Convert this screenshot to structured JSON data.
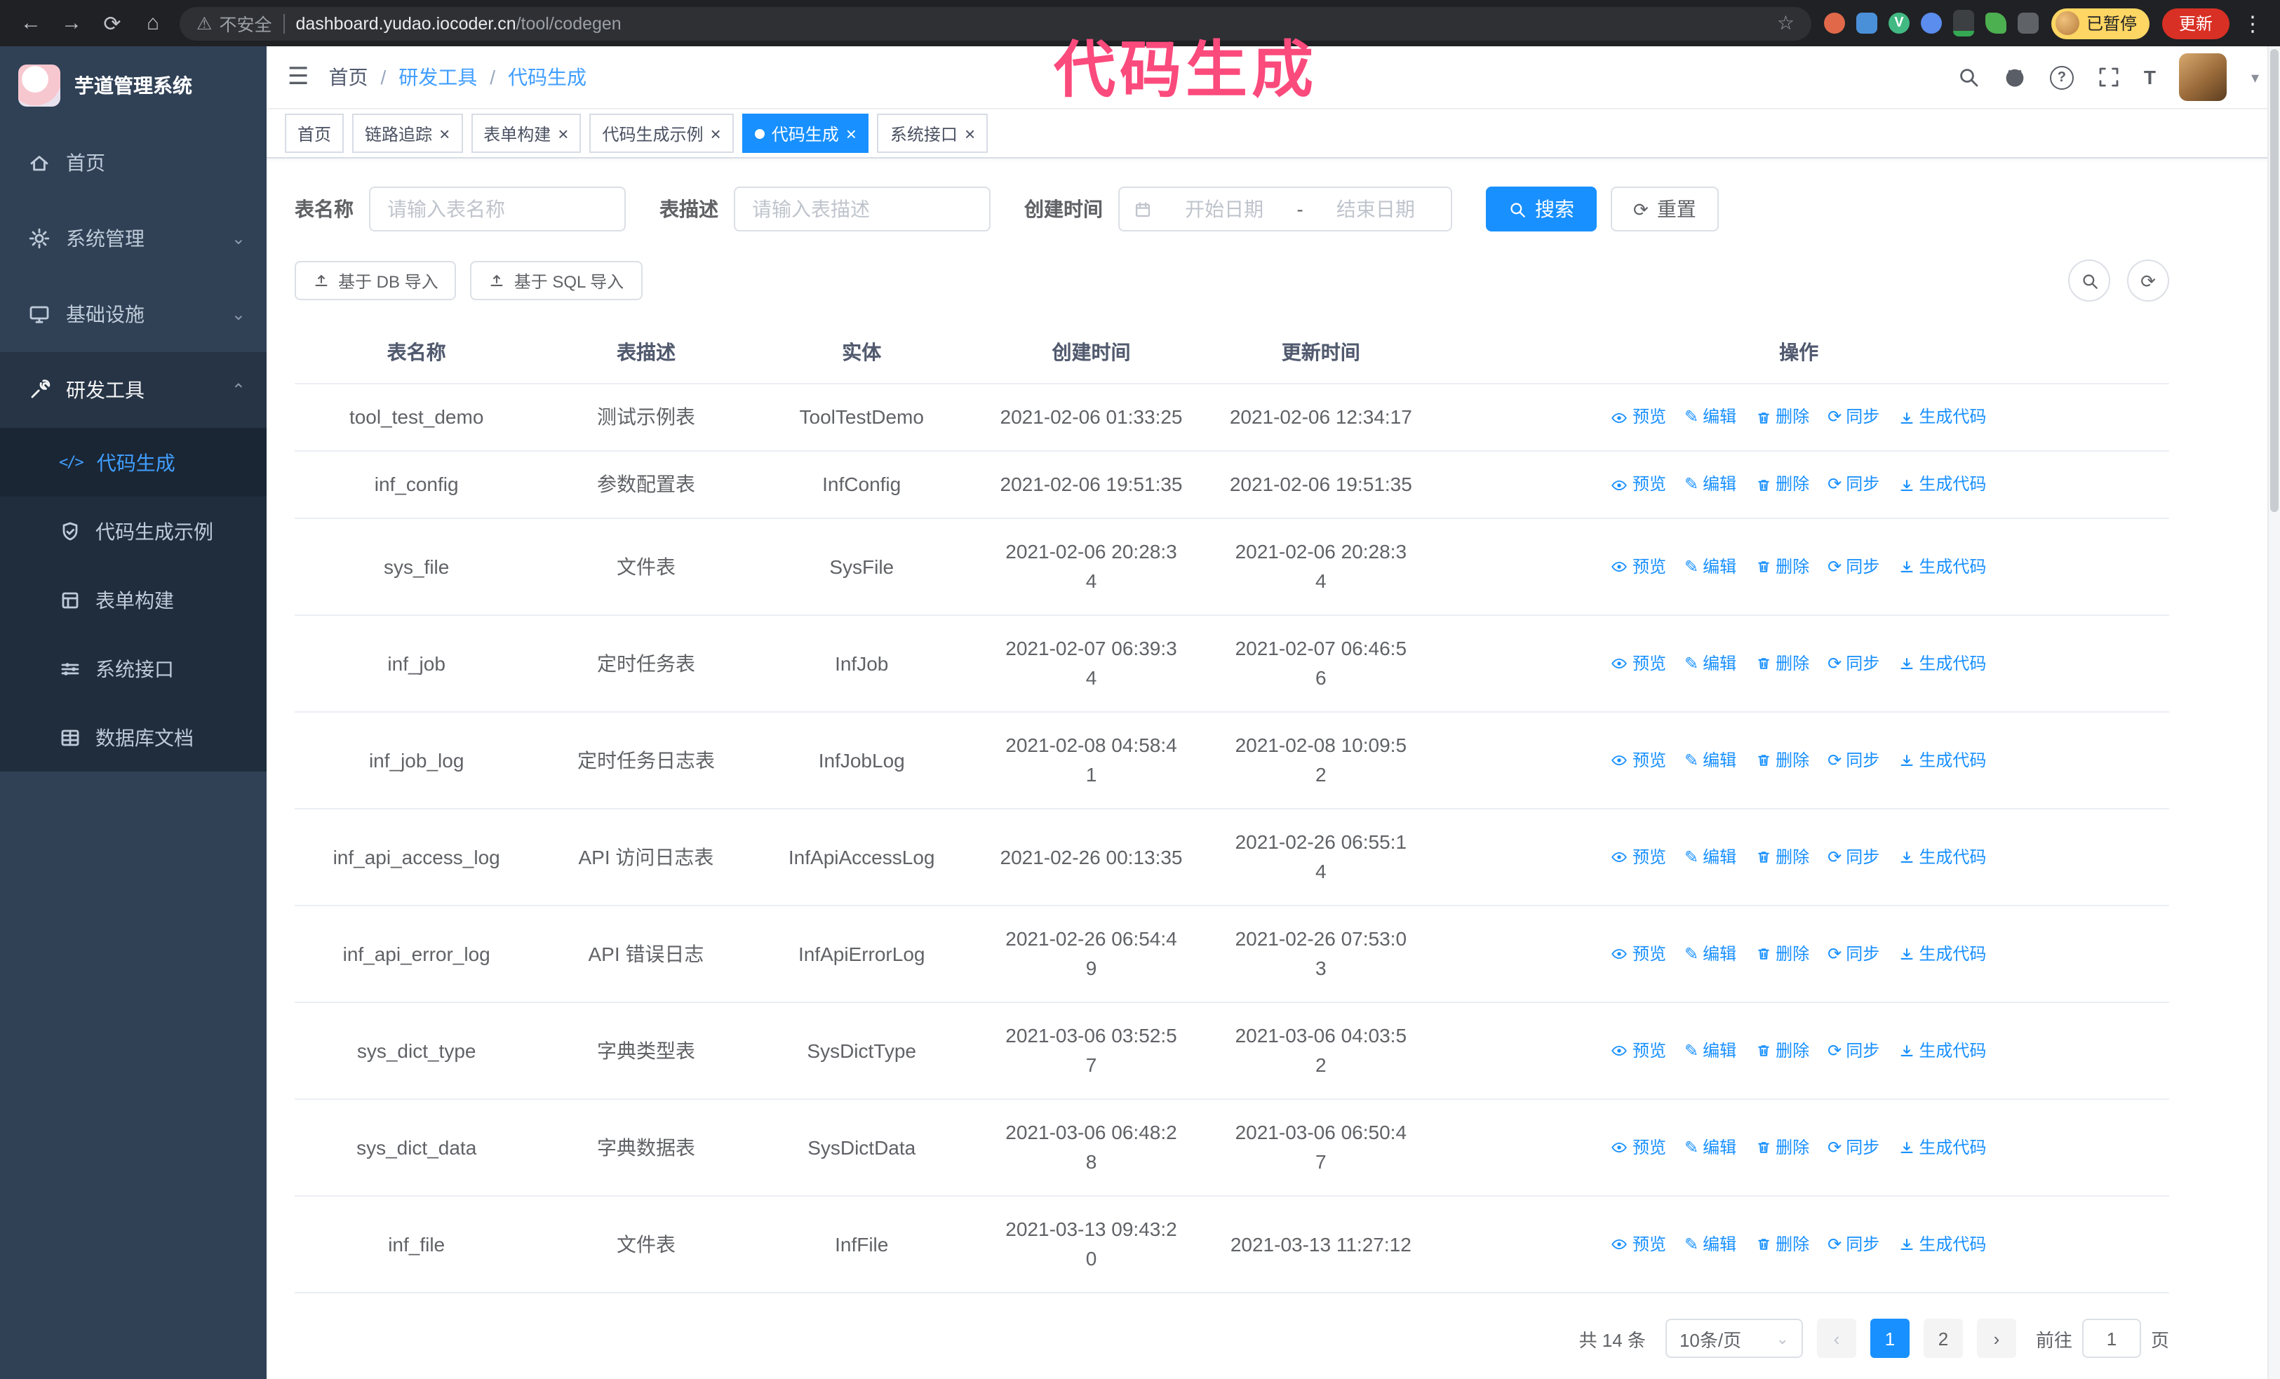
{
  "colors": {
    "accent": "#1890ff",
    "sidebar_bg": "#304156",
    "submenu_bg": "#1f2d3d",
    "active_menu_text": "#409eff",
    "annotation": "#fb4a7c",
    "chrome_bg": "#202124",
    "update_button_bg": "#d93025",
    "paused_badge_bg": "#fdd663",
    "tag_active_bg": "#1890ff"
  },
  "annotation": {
    "text": "代码生成"
  },
  "browser": {
    "security_label": "不安全",
    "url_host": "dashboard.yudao.iocoder.cn",
    "url_path": "/tool/codegen",
    "paused_badge": "已暂停",
    "update_button": "更新"
  },
  "icons": {
    "back": "←",
    "forward": "→",
    "reload": "⟳",
    "home": "⌂",
    "warning": "⚠",
    "star": "☆",
    "dots": "⋮",
    "hamburger": "☰",
    "close": "×",
    "chevron_down": "⌄",
    "chevron_up": "⌃",
    "caret_down": "▾",
    "prev": "‹",
    "next": "›",
    "edit": "✎",
    "sync": "⟳",
    "slash": "/",
    "question": "?",
    "fontsize": "T",
    "code": "</>"
  },
  "sidebar": {
    "logo_title": "芋道管理系统",
    "items": [
      {
        "label": "首页"
      },
      {
        "label": "系统管理"
      },
      {
        "label": "基础设施"
      },
      {
        "label": "研发工具"
      }
    ],
    "submenu": [
      {
        "label": "代码生成",
        "active": true
      },
      {
        "label": "代码生成示例",
        "active": false
      },
      {
        "label": "表单构建",
        "active": false
      },
      {
        "label": "系统接口",
        "active": false
      },
      {
        "label": "数据库文档",
        "active": false
      }
    ]
  },
  "breadcrumb": {
    "items": [
      "首页",
      "研发工具",
      "代码生成"
    ]
  },
  "tags": [
    {
      "label": "首页",
      "closable": false,
      "active": false
    },
    {
      "label": "链路追踪",
      "closable": true,
      "active": false
    },
    {
      "label": "表单构建",
      "closable": true,
      "active": false
    },
    {
      "label": "代码生成示例",
      "closable": true,
      "active": false
    },
    {
      "label": "代码生成",
      "closable": true,
      "active": true
    },
    {
      "label": "系统接口",
      "closable": true,
      "active": false
    }
  ],
  "filters": {
    "table_name_label": "表名称",
    "table_name_placeholder": "请输入表名称",
    "table_desc_label": "表描述",
    "table_desc_placeholder": "请输入表描述",
    "create_time_label": "创建时间",
    "date_start_placeholder": "开始日期",
    "date_separator": "-",
    "date_end_placeholder": "结束日期",
    "search_button": "搜索",
    "reset_button": "重置"
  },
  "toolbar": {
    "import_db_label": "基于 DB 导入",
    "import_sql_label": "基于 SQL 导入"
  },
  "table": {
    "headers": [
      "表名称",
      "表描述",
      "实体",
      "创建时间",
      "更新时间",
      "操作"
    ],
    "actions": [
      "预览",
      "编辑",
      "删除",
      "同步",
      "生成代码"
    ],
    "rows": [
      {
        "name": "tool_test_demo",
        "desc": "测试示例表",
        "entity": "ToolTestDemo",
        "created": "2021-02-06 01:33:25",
        "updated": "2021-02-06 12:34:17"
      },
      {
        "name": "inf_config",
        "desc": "参数配置表",
        "entity": "InfConfig",
        "created": "2021-02-06 19:51:35",
        "updated": "2021-02-06 19:51:35"
      },
      {
        "name": "sys_file",
        "desc": "文件表",
        "entity": "SysFile",
        "created": "2021-02-06 20:28:3\n4",
        "updated": "2021-02-06 20:28:3\n4"
      },
      {
        "name": "inf_job",
        "desc": "定时任务表",
        "entity": "InfJob",
        "created": "2021-02-07 06:39:3\n4",
        "updated": "2021-02-07 06:46:5\n6"
      },
      {
        "name": "inf_job_log",
        "desc": "定时任务日志表",
        "entity": "InfJobLog",
        "created": "2021-02-08 04:58:4\n1",
        "updated": "2021-02-08 10:09:5\n2"
      },
      {
        "name": "inf_api_access_log",
        "desc": "API 访问日志表",
        "entity": "InfApiAccessLog",
        "created": "2021-02-26 00:13:35",
        "updated": "2021-02-26 06:55:1\n4"
      },
      {
        "name": "inf_api_error_log",
        "desc": "API 错误日志",
        "entity": "InfApiErrorLog",
        "created": "2021-02-26 06:54:4\n9",
        "updated": "2021-02-26 07:53:0\n3"
      },
      {
        "name": "sys_dict_type",
        "desc": "字典类型表",
        "entity": "SysDictType",
        "created": "2021-03-06 03:52:5\n7",
        "updated": "2021-03-06 04:03:5\n2"
      },
      {
        "name": "sys_dict_data",
        "desc": "字典数据表",
        "entity": "SysDictData",
        "created": "2021-03-06 06:48:2\n8",
        "updated": "2021-03-06 06:50:4\n7"
      },
      {
        "name": "inf_file",
        "desc": "文件表",
        "entity": "InfFile",
        "created": "2021-03-13 09:43:2\n0",
        "updated": "2021-03-13 11:27:12"
      }
    ]
  },
  "pagination": {
    "total_label": "共 14 条",
    "page_size_label": "10条/页",
    "pages": [
      "1",
      "2"
    ],
    "active_page": "1",
    "goto_label": "前往",
    "goto_value": "1",
    "goto_unit": "页"
  }
}
